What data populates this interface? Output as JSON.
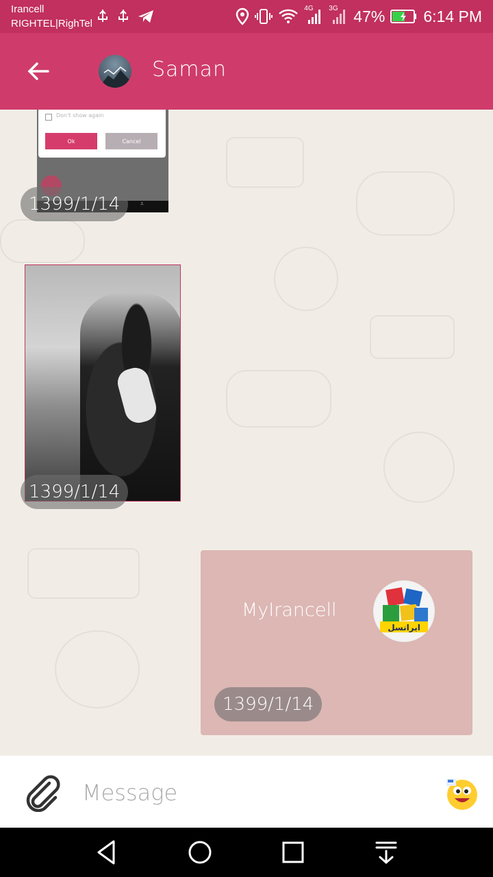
{
  "status_bar": {
    "carrier_line1": "Irancell",
    "carrier_line2": "RIGHTEL|RighTel",
    "network_4g": "4G",
    "network_3g": "3G",
    "battery": "47%",
    "time": "6:14 PM",
    "icons": [
      "usb-icon",
      "usb-icon",
      "telegram-icon",
      "location-icon",
      "vibrate-icon",
      "wifi-icon",
      "signal-icon",
      "signal-icon",
      "battery-charging-icon"
    ]
  },
  "header": {
    "title": "Saman",
    "back_icon": "arrow-left-icon",
    "avatar_icon": "contact-avatar"
  },
  "messages": [
    {
      "type": "image",
      "content": "screenshot-dialog",
      "dialog": {
        "checkbox_text": "Don't show again",
        "ok_label": "Ok",
        "cancel_label": "Cancel"
      },
      "date": "1399/1/14"
    },
    {
      "type": "image",
      "content": "black-and-white-couple-photo",
      "date": "1399/1/14"
    },
    {
      "type": "contact",
      "name": "MyIrancell",
      "logo_text": "ایرانسل",
      "date": "1399/1/14"
    }
  ],
  "composer": {
    "placeholder": "Message",
    "attach_icon": "paperclip-icon",
    "emoji_icon": "emoji-icon"
  },
  "nav_bar": {
    "buttons": [
      "back-triangle-icon",
      "home-circle-icon",
      "recents-square-icon",
      "notification-pull-icon"
    ]
  },
  "colors": {
    "status_bar": "#c1305e",
    "app_bar": "#cf3c6b",
    "bubble_outgoing": "#dcb7b4",
    "chat_background": "#f1ede6"
  }
}
